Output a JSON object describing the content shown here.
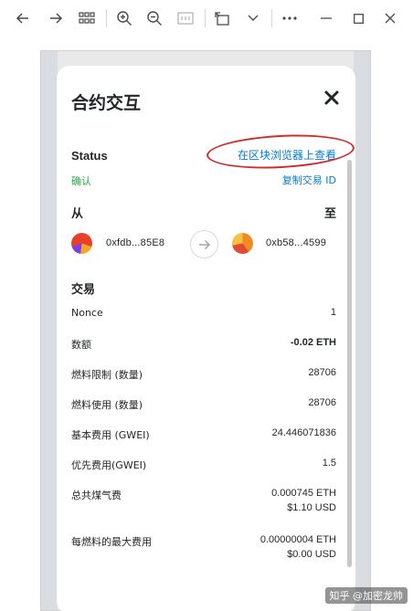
{
  "modal": {
    "title": "合约交互",
    "status_label": "Status",
    "explorer_link": "在区块浏览器上查看",
    "status_value": "确认",
    "copy_tx_id": "复制交易 ID",
    "from_label": "从",
    "to_label": "至",
    "from_address": "0xfdb...85E8",
    "to_address": "0xb58...4599",
    "transaction_label": "交易",
    "rows": [
      {
        "label": "Nonce",
        "value": "1"
      },
      {
        "label": "数额",
        "value": "-0.02 ETH"
      },
      {
        "label": "燃料限制 (数量)",
        "value": "28706"
      },
      {
        "label": "燃料使用 (数量)",
        "value": "28706"
      },
      {
        "label": "基本费用 (GWEI)",
        "value": "24.446071836"
      },
      {
        "label": "优先费用(GWEI)",
        "value": "1.5"
      },
      {
        "label": "总共煤气费",
        "value": "0.000745 ETH",
        "sub_value": "$1.10 USD"
      },
      {
        "label": "每燃料的最大费用",
        "value": "0.00000004 ETH",
        "sub_value": "$0.00 USD"
      }
    ]
  },
  "watermark": "知乎 @加密龙帅",
  "colors": {
    "link": "#037dd6",
    "confirmed": "#28a745",
    "annotation": "#d22b2b"
  }
}
